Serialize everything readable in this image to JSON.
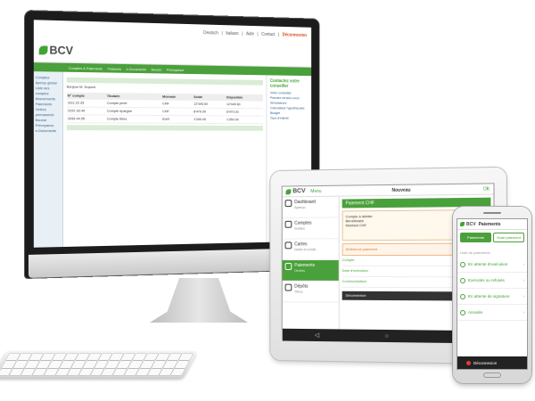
{
  "desktop": {
    "topbar": [
      "Deutsch",
      "Italiano",
      "Aide",
      "Contact",
      "Déconnexion"
    ],
    "brand": "BCV",
    "nav": [
      "Comptes & Paiements",
      "Finances",
      "e-Documents",
      "Bourse",
      "Prévoyance"
    ],
    "side_items": [
      "Comptes",
      "Aperçu global",
      "Liste des comptes",
      "Mouvements",
      "Paiements",
      "Ordres permanents",
      "Bourse",
      "Prévoyance",
      "e-Documents"
    ],
    "greeting": "Bonjour M. Dupont",
    "table_headers": [
      "N° compte",
      "Titulaire",
      "Monnaie",
      "Solde",
      "Disponible"
    ],
    "rows": [
      [
        "1111.22.33",
        "Compte privé",
        "CHF",
        "12'345.60",
        "12'345.60"
      ],
      [
        "2222.33.44",
        "Compte épargne",
        "CHF",
        "8'470.00",
        "8'470.00"
      ],
      [
        "3333.44.55",
        "Compte titres",
        "EUR",
        "1'250.00",
        "1'250.00"
      ]
    ],
    "right_title": "Contactez votre conseiller",
    "right_links": [
      "Votre conseiller",
      "Prendre rendez-vous",
      "Simulateurs",
      "Calculateur hypothécaire",
      "Budget",
      "Taux d'intérêt"
    ]
  },
  "tablet": {
    "brand": "BCV",
    "menu_label": "Menu",
    "title": "Nouveau",
    "ok_label": "OK",
    "side_items": [
      {
        "label": "Dashboard",
        "sub": "Aperçu"
      },
      {
        "label": "Comptes",
        "sub": "Soldes"
      },
      {
        "label": "Cartes",
        "sub": "Débit et crédit"
      },
      {
        "label": "Paiements",
        "sub": "Ordres"
      },
      {
        "label": "Dépôts",
        "sub": "Titres"
      }
    ],
    "green_bar": "Paiement CHF",
    "card_lines": [
      "Compte à débiter",
      "Bénéficiaire",
      "Montant CHF"
    ],
    "orange_line": "Référence paiement",
    "rows": [
      "Compte",
      "Date d'exécution",
      "Communication"
    ],
    "bottom_bar": "Déconnexion"
  },
  "phone": {
    "brand": "BCV",
    "title": "Paiements",
    "tab_active": "Paiements",
    "tab_other": "Scan paiement",
    "list_head": "Liste de paiements",
    "items": [
      "En attente d'exécution",
      "Exécutés ou refusés",
      "En attente de signature",
      "Annulés"
    ],
    "logout": "Déconnexion"
  }
}
